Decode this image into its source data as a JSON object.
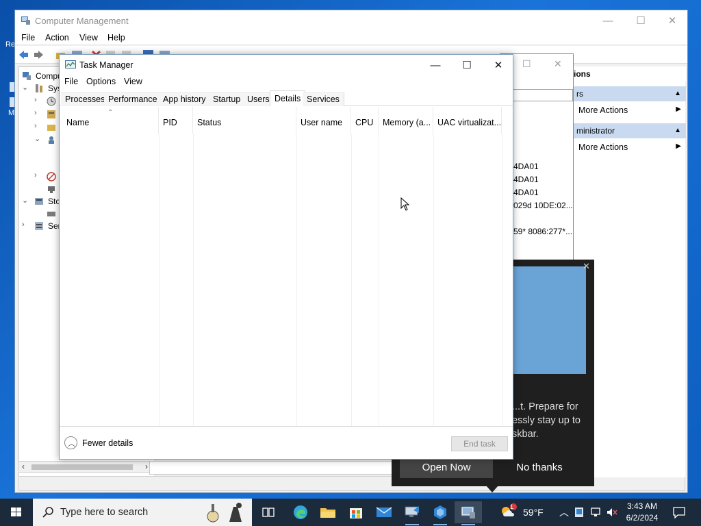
{
  "desktop": {
    "fragment_top": "Re",
    "fragment_bottom": "M"
  },
  "computer_management": {
    "title": "Computer Management",
    "menu": [
      "File",
      "Action",
      "View",
      "Help"
    ],
    "tree": [
      {
        "label": "Comput",
        "chevron": ""
      },
      {
        "label": "Sys",
        "chevron": "⌄"
      },
      {
        "label": "",
        "chevron": "›"
      },
      {
        "label": "",
        "chevron": "›"
      },
      {
        "label": "",
        "chevron": "›"
      },
      {
        "label": "",
        "chevron": "⌄"
      },
      {
        "label": "",
        "chevron": "›"
      },
      {
        "label": "Sto",
        "chevron": "⌄"
      },
      {
        "label": "Ser",
        "chevron": "›"
      }
    ],
    "actions": {
      "header": "ions",
      "section1": "rs",
      "more1": "More Actions",
      "section2": "ministrator",
      "more2": "More Actions"
    }
  },
  "properties_dialog": {
    "lines": [
      "4DA01",
      "4DA01",
      "4DA01",
      "029d 10DE:02...",
      "59* 8086:277*..."
    ]
  },
  "notification": {
    "body": "...t. Prepare for essly stay up to skbar.",
    "body_line1": "...t. Prepare for",
    "body_line2": "essly stay up to",
    "body_line3": "skbar.",
    "primary_button": "Open Now",
    "secondary_button": "No thanks"
  },
  "task_manager": {
    "title": "Task Manager",
    "menu": [
      "File",
      "Options",
      "View"
    ],
    "tabs": [
      "Processes",
      "Performance",
      "App history",
      "Startup",
      "Users",
      "Details",
      "Services"
    ],
    "active_tab": "Details",
    "columns": [
      "Name",
      "PID",
      "Status",
      "User name",
      "CPU",
      "Memory (a...",
      "UAC virtualizat..."
    ],
    "sorted_column": "Name",
    "rows": [],
    "fewer_details": "Fewer details",
    "end_task": "End task"
  },
  "taskbar": {
    "search_placeholder": "Type here to search",
    "weather_temp": "59°F",
    "time": "3:43 AM",
    "date": "6/2/2024",
    "weather_badge": "1",
    "apps": [
      "task-view",
      "edge",
      "file-explorer",
      "microsoft-store",
      "mail",
      "remote-desktop",
      "network-app",
      "computer-management"
    ]
  },
  "colors": {
    "accent": "#0a64d6",
    "taskbar": "#1c2b3c",
    "toast": "#1f1f1f",
    "actions_header": "#c9daf0"
  }
}
